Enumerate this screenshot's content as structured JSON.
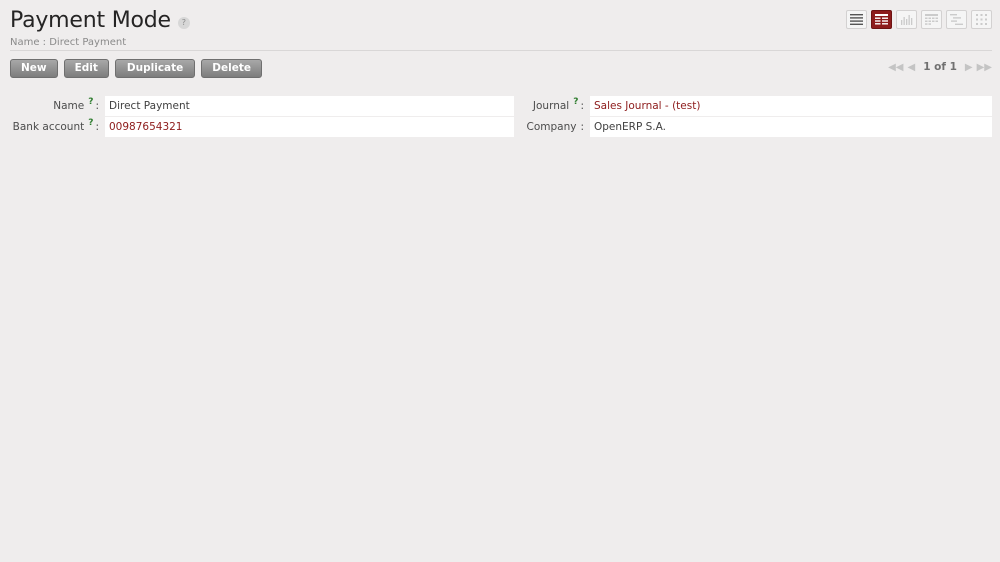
{
  "header": {
    "title": "Payment Mode",
    "help_badge": "?",
    "subtitle": "Name : Direct Payment"
  },
  "view_switch": [
    {
      "name": "list-view-icon",
      "active": false
    },
    {
      "name": "form-view-icon",
      "active": true
    },
    {
      "name": "graph-view-icon",
      "active": false
    },
    {
      "name": "calendar-view-icon",
      "active": false
    },
    {
      "name": "gantt-view-icon",
      "active": false
    },
    {
      "name": "kanban-view-icon",
      "active": false
    }
  ],
  "toolbar": {
    "new_label": "New",
    "edit_label": "Edit",
    "duplicate_label": "Duplicate",
    "delete_label": "Delete"
  },
  "pager": {
    "count_text": "1 of 1"
  },
  "form": {
    "name_label": "Name",
    "name_value": "Direct Payment",
    "journal_label": "Journal",
    "journal_value": "Sales Journal - (test)",
    "bank_account_label": "Bank account",
    "bank_account_value": "00987654321",
    "company_label": "Company",
    "company_value": "OpenERP S.A.",
    "help_mark": "?",
    "separator": ":"
  },
  "colors": {
    "accent": "#8d1b1b",
    "help_green": "#2f7d2f",
    "background": "#efeded"
  }
}
